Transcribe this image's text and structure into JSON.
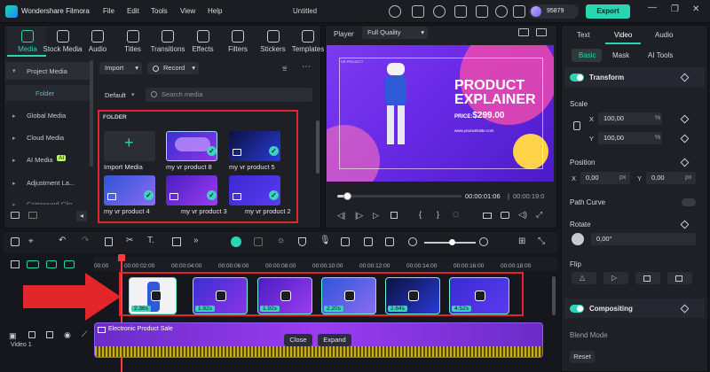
{
  "app": {
    "name": "Wondershare Filmora",
    "window_title": "Untitled",
    "credits": "95879",
    "export_label": "Export"
  },
  "menu": [
    "File",
    "Edit",
    "Tools",
    "View",
    "Help"
  ],
  "media_tabs": [
    {
      "label": "Media",
      "icon": "media-icon"
    },
    {
      "label": "Stock Media",
      "icon": "stock-media-icon"
    },
    {
      "label": "Audio",
      "icon": "audio-icon"
    },
    {
      "label": "Titles",
      "icon": "titles-icon"
    },
    {
      "label": "Transitions",
      "icon": "transitions-icon"
    },
    {
      "label": "Effects",
      "icon": "effects-icon"
    },
    {
      "label": "Filters",
      "icon": "filters-icon"
    },
    {
      "label": "Stickers",
      "icon": "stickers-icon"
    },
    {
      "label": "Templates",
      "icon": "templates-icon"
    }
  ],
  "sidebar": {
    "project_media": "Project Media",
    "folder": "Folder",
    "items": [
      "Global Media",
      "Cloud Media",
      "AI Media",
      "Adjustment La...",
      "Compound Clip"
    ],
    "ai_badge": "AI"
  },
  "toolbar": {
    "import": "Import",
    "record": "Record",
    "sort": "Default",
    "search_placeholder": "Search media"
  },
  "folder_label": "FOLDER",
  "media_items": [
    {
      "label": "Import Media",
      "type": "import"
    },
    {
      "label": "my vr product 8",
      "selected": true
    },
    {
      "label": "my vr product 5"
    },
    {
      "label": "my vr product 4"
    },
    {
      "label": "my vr product 3"
    },
    {
      "label": "my vr product 2"
    }
  ],
  "player": {
    "label": "Player",
    "quality": "Full Quality",
    "current_time": "00:00:01:06",
    "total_time": "00:00:19:0",
    "progress": 0.08,
    "overlay": {
      "title_line1": "PRODUCT",
      "title_line2": "EXPLAINER",
      "price_prefix": "PRICE:",
      "price": "$299.00",
      "site": "www.yourwebsite.com",
      "tag": "VR PROJECT"
    }
  },
  "timeline": {
    "ruler": [
      "00:00",
      "00:00:02:00",
      "00:00:04:00",
      "00:00:06:00",
      "00:00:08:00",
      "00:00:10:00",
      "00:00:12:00",
      "00:00:14:00",
      "00:00:16:00",
      "00:00:18:00"
    ],
    "clips": [
      {
        "duration": "2.36s"
      },
      {
        "duration": "1.92s"
      },
      {
        "duration": "1.92s"
      },
      {
        "duration": "2.20s"
      },
      {
        "duration": "2.64s"
      },
      {
        "duration": "4.52s"
      }
    ],
    "audio_track_title": "Electronic Product Sale",
    "popup": {
      "close": "Close",
      "expand": "Expand"
    },
    "track_label": "Video 1"
  },
  "right_panel": {
    "tabs": [
      "Text",
      "Video",
      "Audio"
    ],
    "active_tab": "Video",
    "subtabs": [
      "Basic",
      "Mask",
      "AI Tools"
    ],
    "active_subtab": "Basic",
    "transform": "Transform",
    "scale": "Scale",
    "scale_x_label": "X",
    "scale_x": "100,00",
    "scale_y_label": "Y",
    "scale_y": "100,00",
    "pct": "%",
    "position": "Position",
    "pos_x_label": "X",
    "pos_x": "0,00",
    "pos_y_label": "Y",
    "pos_y": "0,00",
    "px": "px",
    "path_curve": "Path Curve",
    "rotate": "Rotate",
    "rotate_value": "0,00°",
    "flip": "Flip",
    "compositing": "Compositing",
    "blend_mode": "Blend Mode",
    "reset": "Reset"
  },
  "colors": {
    "accent": "#2ad5b2",
    "highlight": "#e2262a"
  }
}
